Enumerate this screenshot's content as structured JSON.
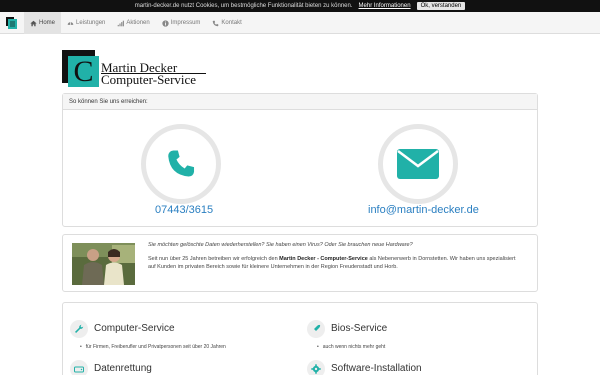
{
  "cookie": {
    "text": "martin-decker.de nutzt Cookies, um bestmögliche Funktionalität bieten zu können.",
    "more_link": "Mehr Informationen",
    "ok_button": "Ok, verstanden"
  },
  "nav": {
    "items": [
      {
        "label": "Home",
        "icon": "home-icon"
      },
      {
        "label": "Leistungen",
        "icon": "dashboard-icon"
      },
      {
        "label": "Aktionen",
        "icon": "signal-icon"
      },
      {
        "label": "Impressum",
        "icon": "info-icon"
      },
      {
        "label": "Kontakt",
        "icon": "phone-icon"
      }
    ]
  },
  "logo": {
    "letter": "C",
    "line1": "Martin Decker",
    "line2": "Computer-Service"
  },
  "contact": {
    "heading": "So können Sie uns erreichen:",
    "phone": "07443/3615",
    "email": "info@martin-decker.de"
  },
  "about": {
    "question": "Sie möchten gelöschte Daten wiederherstellen? Sie haben einen Virus? Oder Sie brauchen neue Hardware?",
    "text_1": "Seit nun über 25 Jahren betreiben wir erfolgreich den ",
    "text_bold": "Martin Decker - Computer-Service",
    "text_2": " als Nebenerwerb in Dornstetten. Wir haben uns spezialisiert auf Kunden im privaten Bereich sowie für kleinere Unternehmen in der Region Freudenstadt und Horb."
  },
  "services": [
    {
      "title": "Computer-Service",
      "icon": "wrench-icon",
      "bullet": "für Firmen, Freiberufler und Privatpersonen seit über 20 Jahren"
    },
    {
      "title": "Bios-Service",
      "icon": "bios-icon",
      "bullet": "auch wenn nichts mehr geht"
    },
    {
      "title": "Datenrettung",
      "icon": "hdd-icon",
      "bullet": ""
    },
    {
      "title": "Software-Installation",
      "icon": "gear-icon",
      "bullet": ""
    }
  ],
  "colors": {
    "accent": "#21b1a8",
    "link": "#2a7fc1",
    "topbar": "#111111"
  }
}
